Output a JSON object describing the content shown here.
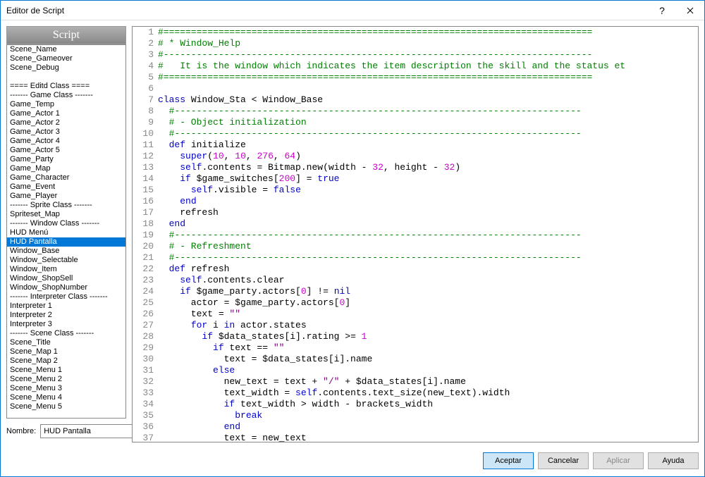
{
  "window": {
    "title": "Editor de Script"
  },
  "sidebar": {
    "header": "Script",
    "items": [
      "Scene_Name",
      "Scene_Gameover",
      "Scene_Debug",
      "",
      "==== Editd Class ====",
      "------- Game Class -------",
      "Game_Temp",
      "Game_Actor 1",
      "Game_Actor 2",
      "Game_Actor 3",
      "Game_Actor 4",
      "Game_Actor 5",
      "Game_Party",
      "Game_Map",
      "Game_Character",
      "Game_Event",
      "Game_Player",
      "------- Sprite Class -------",
      "Spriteset_Map",
      "------- Window Class -------",
      "HUD Menú",
      "HUD Pantalla",
      "Window_Base",
      "Window_Selectable",
      "Window_Item",
      "Window_ShopSell",
      "Window_ShopNumber",
      "------- Interpreter Class -------",
      "Interpreter 1",
      "Interpreter 2",
      "Interpreter 3",
      "------- Scene Class -------",
      "Scene_Title",
      "Scene_Map 1",
      "Scene_Map 2",
      "Scene_Menu 1",
      "Scene_Menu 2",
      "Scene_Menu 3",
      "Scene_Menu 4",
      "Scene_Menu 5"
    ],
    "selected_index": 21
  },
  "name_field": {
    "label": "Nombre:",
    "value": "HUD Pantalla"
  },
  "code_lines": [
    {
      "n": 1,
      "t": "comment",
      "text": "#=============================================================================="
    },
    {
      "n": 2,
      "t": "comment",
      "text": "# * Window_Help"
    },
    {
      "n": 3,
      "t": "comment",
      "text": "#------------------------------------------------------------------------------"
    },
    {
      "n": 4,
      "t": "comment",
      "text": "#   It is the window which indicates the item description the skill and the status et"
    },
    {
      "n": 5,
      "t": "comment",
      "text": "#=============================================================================="
    },
    {
      "n": 6,
      "t": "blank",
      "text": ""
    },
    {
      "n": 7,
      "t": "class",
      "tokens": [
        {
          "c": "c-keyword",
          "v": "class"
        },
        {
          "v": " Window_Sta < Window_Base"
        }
      ]
    },
    {
      "n": 8,
      "t": "comment",
      "text": "  #--------------------------------------------------------------------------"
    },
    {
      "n": 9,
      "t": "comment",
      "text": "  # - Object initialization"
    },
    {
      "n": 10,
      "t": "comment",
      "text": "  #--------------------------------------------------------------------------"
    },
    {
      "n": 11,
      "t": "tok",
      "tokens": [
        {
          "v": "  "
        },
        {
          "c": "c-keyword",
          "v": "def"
        },
        {
          "v": " initialize"
        }
      ]
    },
    {
      "n": 12,
      "t": "tok",
      "tokens": [
        {
          "v": "    "
        },
        {
          "c": "c-keyword",
          "v": "super"
        },
        {
          "v": "("
        },
        {
          "c": "c-num",
          "v": "10"
        },
        {
          "v": ", "
        },
        {
          "c": "c-num",
          "v": "10"
        },
        {
          "v": ", "
        },
        {
          "c": "c-num",
          "v": "276"
        },
        {
          "v": ", "
        },
        {
          "c": "c-num",
          "v": "64"
        },
        {
          "v": ")"
        }
      ]
    },
    {
      "n": 13,
      "t": "tok",
      "tokens": [
        {
          "v": "    "
        },
        {
          "c": "c-keyword",
          "v": "self"
        },
        {
          "v": ".contents = Bitmap.new(width - "
        },
        {
          "c": "c-num",
          "v": "32"
        },
        {
          "v": ", height - "
        },
        {
          "c": "c-num",
          "v": "32"
        },
        {
          "v": ")"
        }
      ]
    },
    {
      "n": 14,
      "t": "tok",
      "tokens": [
        {
          "v": "    "
        },
        {
          "c": "c-keyword",
          "v": "if"
        },
        {
          "v": " $game_switches["
        },
        {
          "c": "c-num",
          "v": "200"
        },
        {
          "v": "] = "
        },
        {
          "c": "c-keyword",
          "v": "true"
        }
      ]
    },
    {
      "n": 15,
      "t": "tok",
      "tokens": [
        {
          "v": "      "
        },
        {
          "c": "c-keyword",
          "v": "self"
        },
        {
          "v": ".visible = "
        },
        {
          "c": "c-keyword",
          "v": "false"
        }
      ]
    },
    {
      "n": 16,
      "t": "tok",
      "tokens": [
        {
          "v": "    "
        },
        {
          "c": "c-keyword",
          "v": "end"
        }
      ]
    },
    {
      "n": 17,
      "t": "tok",
      "tokens": [
        {
          "v": "    refresh"
        }
      ]
    },
    {
      "n": 18,
      "t": "tok",
      "tokens": [
        {
          "v": "  "
        },
        {
          "c": "c-keyword",
          "v": "end"
        }
      ]
    },
    {
      "n": 19,
      "t": "comment",
      "text": "  #--------------------------------------------------------------------------"
    },
    {
      "n": 20,
      "t": "comment",
      "text": "  # - Refreshment"
    },
    {
      "n": 21,
      "t": "comment",
      "text": "  #--------------------------------------------------------------------------"
    },
    {
      "n": 22,
      "t": "tok",
      "tokens": [
        {
          "v": "  "
        },
        {
          "c": "c-keyword",
          "v": "def"
        },
        {
          "v": " refresh"
        }
      ]
    },
    {
      "n": 23,
      "t": "tok",
      "tokens": [
        {
          "v": "    "
        },
        {
          "c": "c-keyword",
          "v": "self"
        },
        {
          "v": ".contents.clear"
        }
      ]
    },
    {
      "n": 24,
      "t": "tok",
      "tokens": [
        {
          "v": "    "
        },
        {
          "c": "c-keyword",
          "v": "if"
        },
        {
          "v": " $game_party.actors["
        },
        {
          "c": "c-num",
          "v": "0"
        },
        {
          "v": "] != "
        },
        {
          "c": "c-keyword",
          "v": "nil"
        }
      ]
    },
    {
      "n": 25,
      "t": "tok",
      "tokens": [
        {
          "v": "      actor = $game_party.actors["
        },
        {
          "c": "c-num",
          "v": "0"
        },
        {
          "v": "]"
        }
      ]
    },
    {
      "n": 26,
      "t": "tok",
      "tokens": [
        {
          "v": "      text = "
        },
        {
          "c": "c-string",
          "v": "\"\""
        }
      ]
    },
    {
      "n": 27,
      "t": "tok",
      "tokens": [
        {
          "v": "      "
        },
        {
          "c": "c-keyword",
          "v": "for"
        },
        {
          "v": " i "
        },
        {
          "c": "c-keyword",
          "v": "in"
        },
        {
          "v": " actor.states"
        }
      ]
    },
    {
      "n": 28,
      "t": "tok",
      "tokens": [
        {
          "v": "        "
        },
        {
          "c": "c-keyword",
          "v": "if"
        },
        {
          "v": " $data_states[i].rating >= "
        },
        {
          "c": "c-num",
          "v": "1"
        }
      ]
    },
    {
      "n": 29,
      "t": "tok",
      "tokens": [
        {
          "v": "          "
        },
        {
          "c": "c-keyword",
          "v": "if"
        },
        {
          "v": " text == "
        },
        {
          "c": "c-string",
          "v": "\"\""
        }
      ]
    },
    {
      "n": 30,
      "t": "tok",
      "tokens": [
        {
          "v": "            text = $data_states[i].name"
        }
      ]
    },
    {
      "n": 31,
      "t": "tok",
      "tokens": [
        {
          "v": "          "
        },
        {
          "c": "c-keyword",
          "v": "else"
        }
      ]
    },
    {
      "n": 32,
      "t": "tok",
      "tokens": [
        {
          "v": "            new_text = text + "
        },
        {
          "c": "c-string",
          "v": "\"/\""
        },
        {
          "v": " + $data_states[i].name"
        }
      ]
    },
    {
      "n": 33,
      "t": "tok",
      "tokens": [
        {
          "v": "            text_width = "
        },
        {
          "c": "c-keyword",
          "v": "self"
        },
        {
          "v": ".contents.text_size(new_text).width"
        }
      ]
    },
    {
      "n": 34,
      "t": "tok",
      "tokens": [
        {
          "v": "            "
        },
        {
          "c": "c-keyword",
          "v": "if"
        },
        {
          "v": " text_width > width - brackets_width"
        }
      ]
    },
    {
      "n": 35,
      "t": "tok",
      "tokens": [
        {
          "v": "              "
        },
        {
          "c": "c-keyword",
          "v": "break"
        }
      ]
    },
    {
      "n": 36,
      "t": "tok",
      "tokens": [
        {
          "v": "            "
        },
        {
          "c": "c-keyword",
          "v": "end"
        }
      ]
    },
    {
      "n": 37,
      "t": "tok",
      "tokens": [
        {
          "v": "            text = new_text"
        }
      ]
    }
  ],
  "buttons": {
    "ok": "Aceptar",
    "cancel": "Cancelar",
    "apply": "Aplicar",
    "help": "Ayuda"
  }
}
